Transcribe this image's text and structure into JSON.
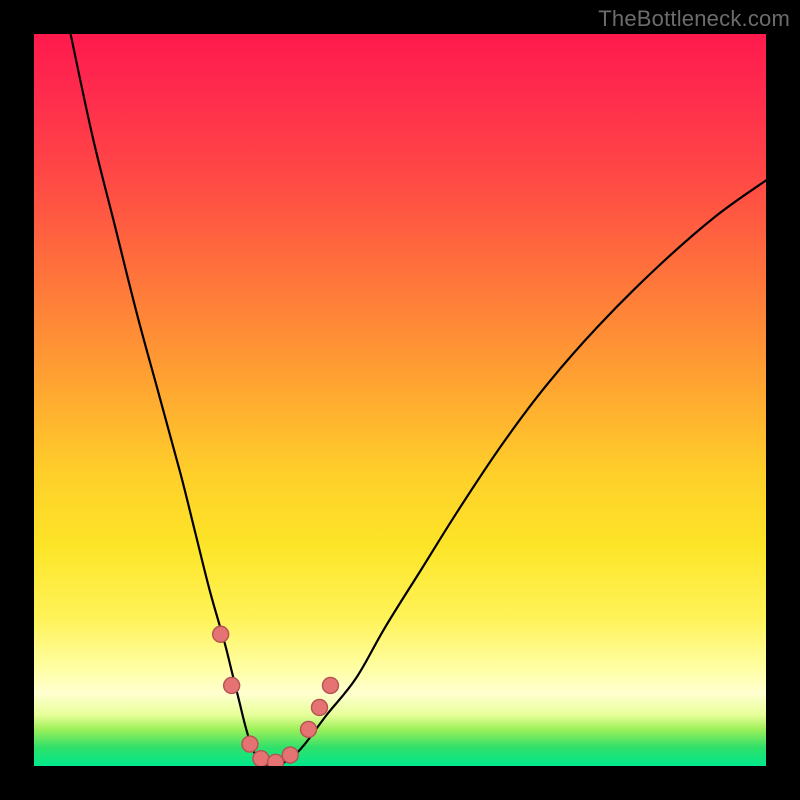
{
  "watermark": "TheBottleneck.com",
  "colors": {
    "frame": "#000000",
    "curve": "#000000",
    "marker_fill": "#e57373",
    "marker_stroke": "#b55252",
    "gradient_top": "#ff1a4d",
    "gradient_bottom": "#00e88c"
  },
  "chart_data": {
    "type": "line",
    "title": "",
    "xlabel": "",
    "ylabel": "",
    "xlim": [
      0,
      100
    ],
    "ylim": [
      0,
      100
    ],
    "grid": false,
    "series": [
      {
        "name": "curve",
        "x": [
          5,
          8,
          11,
          14,
          17,
          20,
          22,
          24,
          26,
          27,
          28,
          29,
          30,
          31,
          32,
          33,
          35,
          37,
          40,
          44,
          48,
          53,
          58,
          64,
          70,
          77,
          85,
          93,
          100
        ],
        "y": [
          100,
          86,
          74,
          62,
          51,
          40,
          32,
          24,
          17,
          13,
          9,
          5,
          2,
          1,
          0,
          0,
          1,
          3,
          7,
          12,
          19,
          27,
          35,
          44,
          52,
          60,
          68,
          75,
          80
        ]
      }
    ],
    "annotations": {
      "markers_on_curve": [
        {
          "x": 25.5,
          "y": 18
        },
        {
          "x": 27,
          "y": 11
        },
        {
          "x": 29.5,
          "y": 3
        },
        {
          "x": 31,
          "y": 1
        },
        {
          "x": 33,
          "y": 0.5
        },
        {
          "x": 35,
          "y": 1.5
        },
        {
          "x": 37.5,
          "y": 5
        },
        {
          "x": 39,
          "y": 8
        },
        {
          "x": 40.5,
          "y": 11
        }
      ],
      "marker_radius_px": 8
    }
  }
}
